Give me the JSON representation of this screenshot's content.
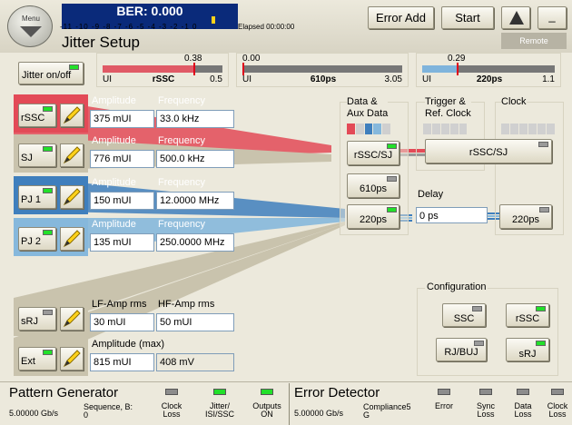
{
  "header": {
    "menu": "Menu",
    "ber": "BER: 0.000",
    "scale": "-11 -10 -9 -8 -7 -6 -5 -4 -3 -2 -1 0",
    "elapsed": "Elapsed 00:00:00",
    "error_add": "Error Add",
    "start": "Start",
    "minimize": "_",
    "remote": "Remote",
    "title": "Jitter Setup"
  },
  "jitter_toggle": "Jitter on/off",
  "meters": [
    {
      "top": "0.38",
      "left": "UI",
      "mid": "rSSC",
      "right": "0.5",
      "fraction": 0.76,
      "color": "#e05a66"
    },
    {
      "top": "0.00",
      "left": "UI",
      "mid": "610ps",
      "right": "3.05",
      "fraction": 0.0,
      "color": "#777"
    },
    {
      "top": "0.29",
      "left": "UI",
      "mid": "220ps",
      "right": "1.1",
      "fraction": 0.26,
      "color": "#7fb4dc"
    }
  ],
  "rows": [
    {
      "btn": "rSSC",
      "l1": "Amplitude",
      "l2": "Frequency",
      "v1": "375 mUI",
      "v2": "33.0 kHz"
    },
    {
      "btn": "SJ",
      "l1": "Amplitude",
      "l2": "Frequency",
      "v1": "776 mUI",
      "v2": "500.0 kHz"
    },
    {
      "btn": "PJ 1",
      "l1": "Amplitude",
      "l2": "Frequency",
      "v1": "150 mUI",
      "v2": "12.0000 MHz"
    },
    {
      "btn": "PJ 2",
      "l1": "Amplitude",
      "l2": "Frequency",
      "v1": "135 mUI",
      "v2": "250.0000 MHz"
    },
    {
      "btn": "sRJ",
      "l1": "LF-Amp rms",
      "l2": "HF-Amp rms",
      "v1": "30 mUI",
      "v2": "50 mUI"
    },
    {
      "btn": "Ext",
      "l1": "Amplitude (max)",
      "l2": "",
      "v1": "815 mUI",
      "v2": "408 mV"
    }
  ],
  "routing": {
    "data_aux": "Data &\nAux Data",
    "trigger": "Trigger &\nRef. Clock",
    "clock": "Clock",
    "rssc_sj_a": "rSSC/SJ",
    "rssc_sj_b": "rSSC/SJ",
    "ps610": "610ps",
    "ps220": "220ps",
    "delay_label": "Delay",
    "delay_value": "0 ps",
    "clock_220": "220ps"
  },
  "configuration": {
    "title": "Configuration",
    "ssc": "SSC",
    "rssc": "rSSC",
    "rj_buj": "RJ/BUJ",
    "srj": "sRJ"
  },
  "status": {
    "pg_title": "Pattern Generator",
    "pg_rate": "5.00000 Gb/s",
    "pg_seq": "Sequence, B:\n0",
    "pg_leds": [
      {
        "label": "Clock\nLoss",
        "color": "#8c8c8c"
      },
      {
        "label": "Jitter/\nISI/SSC",
        "color": "#22e02a"
      },
      {
        "label": "Outputs\nON",
        "color": "#22e02a"
      }
    ],
    "ed_title": "Error Detector",
    "ed_rate": "5.00000 Gb/s",
    "ed_comp": "Compliance5\nG",
    "ed_leds": [
      {
        "label": "Error",
        "color": "#8c8c8c"
      },
      {
        "label": "Sync\nLoss",
        "color": "#8c8c8c"
      },
      {
        "label": "Data\nLoss",
        "color": "#8c8c8c"
      },
      {
        "label": "Clock\nLoss",
        "color": "#8c8c8c"
      }
    ]
  }
}
